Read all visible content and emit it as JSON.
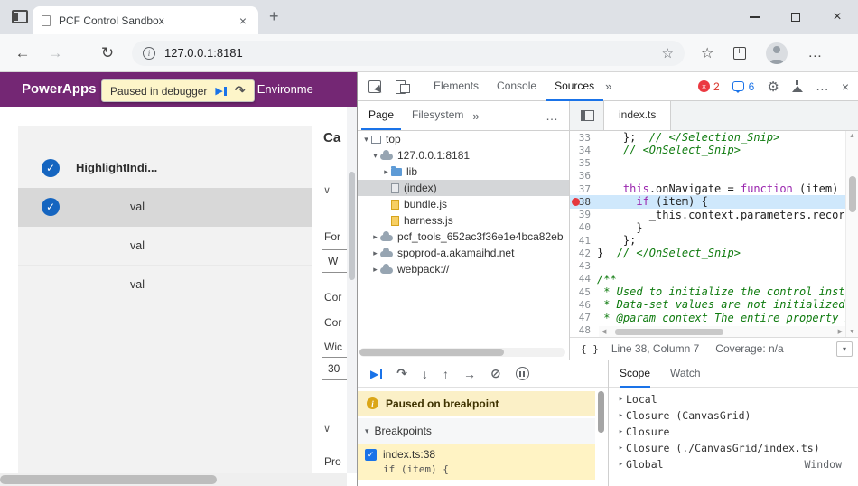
{
  "icons": {
    "back": "←",
    "forward": "→",
    "reload": "↻",
    "star": "☆",
    "favorites": "☆",
    "new_tab": "+",
    "close": "×",
    "more": "»",
    "overflow": "…",
    "gear": "⚙",
    "tree_down": "▾",
    "tree_right": "▸",
    "chevron": "∨",
    "check": "✓",
    "resume": "▶",
    "step_over": "↷",
    "step_into": "↓",
    "step_out": "↑",
    "step": "→",
    "deactivate": "⊘",
    "brackets": "{ }",
    "info_i": "i",
    "scroll_left": "◀",
    "scroll_right": "▶",
    "scroll_up": "▲",
    "scroll_down": "▼"
  },
  "window": {
    "tab_title": "PCF Control Sandbox",
    "url": "127.0.0.1:8181"
  },
  "page": {
    "header": {
      "brand": "PowerApps",
      "env_fragment": "st Environme"
    },
    "paused_overlay": {
      "label": "Paused in debugger"
    },
    "grid": {
      "header_label": "HighlightIndi...",
      "rows": [
        {
          "value": "val",
          "checked": true,
          "selected": true
        },
        {
          "value": "val",
          "checked": false,
          "selected": false
        },
        {
          "value": "val",
          "checked": false,
          "selected": false
        }
      ]
    },
    "props": {
      "heading": "Ca",
      "form_label": "For",
      "select_value": "W",
      "label_1": "Cor",
      "label_2": "Cor",
      "label_3": "Wic",
      "input_value": "30",
      "section_label": "Pro"
    }
  },
  "devtools": {
    "toolbar": {
      "tabs": [
        {
          "label": "Elements"
        },
        {
          "label": "Console"
        },
        {
          "label": "Sources"
        }
      ],
      "error_count": "2",
      "message_count": "6"
    },
    "navigator": {
      "tabs": [
        {
          "label": "Page"
        },
        {
          "label": "Filesystem"
        }
      ],
      "tree": [
        {
          "label": "top"
        },
        {
          "label": "127.0.0.1:8181"
        },
        {
          "label": "lib"
        },
        {
          "label": "(index)"
        },
        {
          "label": "bundle.js"
        },
        {
          "label": "harness.js"
        },
        {
          "label": "pcf_tools_652ac3f36e1e4bca82eb"
        },
        {
          "label": "spoprod-a.akamaihd.net"
        },
        {
          "label": "webpack://"
        }
      ]
    },
    "editor": {
      "file_tab": "index.ts",
      "lines": [
        {
          "n": "33",
          "tokens": [
            {
              "t": "    };  "
            },
            {
              "t": "// </Selection_Snip>"
            }
          ]
        },
        {
          "n": "34",
          "tokens": [
            {
              "t": "    // <OnSelect_Snip>"
            }
          ]
        },
        {
          "n": "35",
          "tokens": []
        },
        {
          "n": "36",
          "tokens": []
        },
        {
          "n": "37",
          "tokens": [
            {
              "t": "    "
            },
            {
              "t": "this"
            },
            {
              "t": ".onNavigate = "
            },
            {
              "t": "function"
            },
            {
              "t": " (item) {"
            }
          ]
        },
        {
          "n": "38",
          "tokens": [
            {
              "t": "      "
            },
            {
              "t": "if"
            },
            {
              "t": " (item) {"
            }
          ]
        },
        {
          "n": "39",
          "tokens": [
            {
              "t": "        _this.context.parameters.records.openDatasetItem(item.getNamedReference());"
            }
          ]
        },
        {
          "n": "40",
          "tokens": [
            {
              "t": "      }"
            }
          ]
        },
        {
          "n": "41",
          "tokens": [
            {
              "t": "    };"
            }
          ]
        },
        {
          "n": "42",
          "tokens": [
            {
              "t": "}  "
            },
            {
              "t": "// </OnSelect_Snip>"
            }
          ]
        },
        {
          "n": "43",
          "tokens": []
        },
        {
          "n": "44",
          "tokens": [
            {
              "t": "/**"
            }
          ]
        },
        {
          "n": "45",
          "tokens": [
            {
              "t": " * Used to initialize the control instance."
            }
          ]
        },
        {
          "n": "46",
          "tokens": [
            {
              "t": " * Data-set values are not initialized here, use updateView."
            }
          ]
        },
        {
          "n": "47",
          "tokens": [
            {
              "t": " * @param context The entire property bag available to control via Context Object;"
            }
          ]
        },
        {
          "n": "48",
          "tokens": []
        }
      ]
    },
    "status": {
      "position": "Line 38, Column 7",
      "coverage": "Coverage: n/a"
    },
    "debug": {
      "paused_message": "Paused on breakpoint",
      "breakpoints_title": "Breakpoints",
      "breakpoint_label": "index.ts:38",
      "breakpoint_code": "if (item) {"
    },
    "scope": {
      "tabs": [
        {
          "label": "Scope"
        },
        {
          "label": "Watch"
        }
      ],
      "items": [
        {
          "label": "Local",
          "value": ""
        },
        {
          "label": "Closure (CanvasGrid)",
          "value": ""
        },
        {
          "label": "Closure",
          "value": ""
        },
        {
          "label": "Closure (./CanvasGrid/index.ts)",
          "value": ""
        },
        {
          "label": "Global",
          "value": "Window"
        }
      ]
    }
  }
}
